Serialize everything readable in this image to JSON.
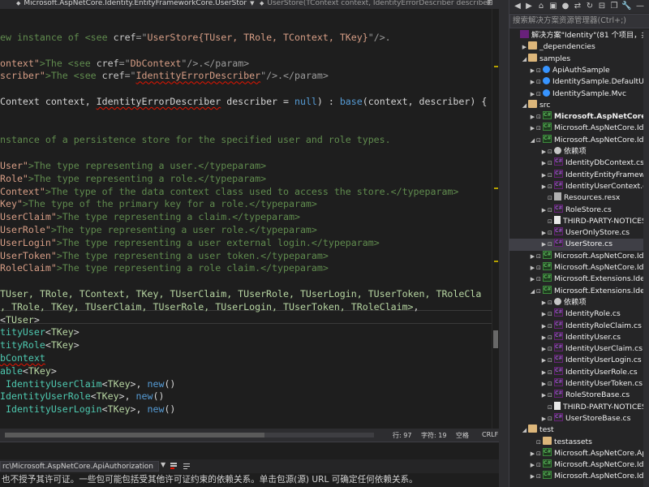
{
  "editor": {
    "tab_left": "Microsoft.AspNetCore.Identity.EntityFrameworkCore.UserStor",
    "tab_right": "UserStore(TContext context, IdentityErrorDescriber describer",
    "code_lines": [
      [
        {
          "t": "ew instance of <see ",
          "c": "c-doc"
        },
        {
          "t": "cref",
          "c": "c-attr"
        },
        {
          "t": "=\"",
          "c": "c-tag"
        },
        {
          "t": "UserStore{TUser, TRole, TContext, TKey}",
          "c": "c-str"
        },
        {
          "t": "\"/>.",
          "c": "c-tag"
        }
      ],
      [],
      [
        {
          "t": "ontext\"",
          "c": "c-str"
        },
        {
          "t": ">The <see ",
          "c": "c-doc"
        },
        {
          "t": "cref",
          "c": "c-attr"
        },
        {
          "t": "=\"",
          "c": "c-tag"
        },
        {
          "t": "DbContext",
          "c": "c-str"
        },
        {
          "t": "\"/>.</param>",
          "c": "c-tag"
        }
      ],
      [
        {
          "t": "scriber\"",
          "c": "c-str"
        },
        {
          "t": ">The <see ",
          "c": "c-doc"
        },
        {
          "t": "cref",
          "c": "c-attr"
        },
        {
          "t": "=\"",
          "c": "c-tag"
        },
        {
          "t": "IdentityErrorDescriber",
          "c": "c-str",
          "sq": true
        },
        {
          "t": "\"/>.</param>",
          "c": "c-tag"
        }
      ],
      [],
      [
        {
          "t": "Context context, ",
          "c": "c-plain"
        },
        {
          "t": "IdentityErrorDescriber",
          "c": "c-plain",
          "sq": true
        },
        {
          "t": " describer = ",
          "c": "c-plain"
        },
        {
          "t": "null",
          "c": "c-kw"
        },
        {
          "t": ") : ",
          "c": "c-plain"
        },
        {
          "t": "base",
          "c": "c-kw"
        },
        {
          "t": "(context, describer) {",
          "c": "c-plain"
        }
      ],
      [],
      [],
      [
        {
          "t": "nstance of a persistence store for the specified user and role types.",
          "c": "c-doc"
        }
      ],
      [],
      [
        {
          "t": "User\"",
          "c": "c-str"
        },
        {
          "t": ">The type representing a user.</typeparam>",
          "c": "c-doc"
        }
      ],
      [
        {
          "t": "Role\"",
          "c": "c-str"
        },
        {
          "t": ">The type representing a role.</typeparam>",
          "c": "c-doc"
        }
      ],
      [
        {
          "t": "Context\"",
          "c": "c-str"
        },
        {
          "t": ">The type of the data context class used to access the store.</typeparam>",
          "c": "c-doc"
        }
      ],
      [
        {
          "t": "Key\"",
          "c": "c-str"
        },
        {
          "t": ">The type of the primary key for a role.</typeparam>",
          "c": "c-doc"
        }
      ],
      [
        {
          "t": "UserClaim\"",
          "c": "c-str"
        },
        {
          "t": ">The type representing a claim.</typeparam>",
          "c": "c-doc"
        }
      ],
      [
        {
          "t": "UserRole\"",
          "c": "c-str"
        },
        {
          "t": ">The type representing a user role.</typeparam>",
          "c": "c-doc"
        }
      ],
      [
        {
          "t": "UserLogin\"",
          "c": "c-str"
        },
        {
          "t": ">The type representing a user external login.</typeparam>",
          "c": "c-doc"
        }
      ],
      [
        {
          "t": "UserToken\"",
          "c": "c-str"
        },
        {
          "t": ">The type representing a user token.</typeparam>",
          "c": "c-doc"
        }
      ],
      [
        {
          "t": "RoleClaim\"",
          "c": "c-str"
        },
        {
          "t": ">The type representing a role claim.</typeparam>",
          "c": "c-doc"
        }
      ],
      [],
      [
        {
          "t": "TUser, TRole, TContext, TKey, TUserClaim, TUserRole, TUserLogin, TUserToken, TRoleCla",
          "c": "c-tp"
        }
      ],
      [
        {
          "t": ", TRole, TKey, TUserClaim, TUserRole, TUserLogin, TUserToken, TRoleClaim>",
          "c": "c-tp"
        },
        {
          "t": ",",
          "c": "c-plain"
        }
      ],
      [
        {
          "t": "<",
          "c": "c-plain"
        },
        {
          "t": "TUser",
          "c": "c-tp"
        },
        {
          "t": ">",
          "c": "c-plain"
        }
      ],
      [
        {
          "t": "tityUser",
          "c": "c-type"
        },
        {
          "t": "<",
          "c": "c-plain"
        },
        {
          "t": "TKey",
          "c": "c-tp"
        },
        {
          "t": ">",
          "c": "c-plain"
        }
      ],
      [
        {
          "t": "tityRole",
          "c": "c-type"
        },
        {
          "t": "<",
          "c": "c-plain"
        },
        {
          "t": "TKey",
          "c": "c-tp"
        },
        {
          "t": ">",
          "c": "c-plain"
        }
      ],
      [
        {
          "t": "bContext",
          "c": "c-type",
          "sq": true
        }
      ],
      [
        {
          "t": "able",
          "c": "c-type"
        },
        {
          "t": "<",
          "c": "c-plain"
        },
        {
          "t": "TKey",
          "c": "c-tp"
        },
        {
          "t": ">",
          "c": "c-plain"
        }
      ],
      [
        {
          "t": " IdentityUserClaim",
          "c": "c-type"
        },
        {
          "t": "<",
          "c": "c-plain"
        },
        {
          "t": "TKey",
          "c": "c-tp"
        },
        {
          "t": ">, ",
          "c": "c-plain"
        },
        {
          "t": "new",
          "c": "c-kw"
        },
        {
          "t": "()",
          "c": "c-plain"
        }
      ],
      [
        {
          "t": "IdentityUserRole",
          "c": "c-type"
        },
        {
          "t": "<",
          "c": "c-plain"
        },
        {
          "t": "TKey",
          "c": "c-tp"
        },
        {
          "t": ">, ",
          "c": "c-plain"
        },
        {
          "t": "new",
          "c": "c-kw"
        },
        {
          "t": "()",
          "c": "c-plain"
        }
      ],
      [
        {
          "t": " IdentityUserLogin",
          "c": "c-type"
        },
        {
          "t": "<",
          "c": "c-plain"
        },
        {
          "t": "TKey",
          "c": "c-tp"
        },
        {
          "t": ">, ",
          "c": "c-plain"
        },
        {
          "t": "new",
          "c": "c-kw"
        },
        {
          "t": "()",
          "c": "c-plain"
        }
      ]
    ]
  },
  "status": {
    "line": "行: 97",
    "char": "字符: 19",
    "spaces": "空格",
    "eol": "CRLF"
  },
  "output": {
    "source_combo": "rc\\Microsoft.AspNetCore.ApiAuthorization",
    "message": "也不授予其许可证。一些包可能包括受其他许可证约束的依赖关系。单击包源(源) URL 可确定任何依赖关系。"
  },
  "solution_explorer": {
    "search_placeholder": "搜索解决方案资源管理器(Ctrl+;)",
    "items": [
      {
        "label": "解决方案\"Identity\"(81 个项目，共 8",
        "depth": 0,
        "chev": "",
        "icon": "ic-sln",
        "bold": false
      },
      {
        "label": "_dependencies",
        "depth": 1,
        "chev": "▶",
        "icon": "ic-folder",
        "bold": false
      },
      {
        "label": "samples",
        "depth": 1,
        "chev": "◢",
        "icon": "ic-folder",
        "bold": false
      },
      {
        "label": "ApiAuthSample",
        "depth": 2,
        "chev": "▶",
        "icon": "ic-globe",
        "bold": false
      },
      {
        "label": "IdentitySample.DefaultUI",
        "depth": 2,
        "chev": "▶",
        "icon": "ic-globe",
        "bold": false
      },
      {
        "label": "IdentitySample.Mvc",
        "depth": 2,
        "chev": "▶",
        "icon": "ic-globe",
        "bold": false
      },
      {
        "label": "src",
        "depth": 1,
        "chev": "◢",
        "icon": "ic-folder",
        "bold": false
      },
      {
        "label": "Microsoft.AspNetCore.ApiAu",
        "depth": 2,
        "chev": "▶",
        "icon": "ic-csproj",
        "bold": true
      },
      {
        "label": "Microsoft.AspNetCore.Identi",
        "depth": 2,
        "chev": "▶",
        "icon": "ic-csproj",
        "bold": false
      },
      {
        "label": "Microsoft.AspNetCore.Identi",
        "depth": 2,
        "chev": "◢",
        "icon": "ic-csproj",
        "bold": false
      },
      {
        "label": "依赖项",
        "depth": 3,
        "chev": "▶",
        "icon": "ic-deps",
        "bold": false
      },
      {
        "label": "IdentityDbContext.cs",
        "depth": 3,
        "chev": "▶",
        "icon": "ic-cs",
        "bold": false
      },
      {
        "label": "IdentityEntityFramework",
        "depth": 3,
        "chev": "▶",
        "icon": "ic-cs",
        "bold": false
      },
      {
        "label": "IdentityUserContext.cs",
        "depth": 3,
        "chev": "▶",
        "icon": "ic-cs",
        "bold": false
      },
      {
        "label": "Resources.resx",
        "depth": 3,
        "chev": "",
        "icon": "ic-res",
        "bold": false
      },
      {
        "label": "RoleStore.cs",
        "depth": 3,
        "chev": "▶",
        "icon": "ic-cs",
        "bold": false
      },
      {
        "label": "THIRD-PARTY-NOTICES.t",
        "depth": 3,
        "chev": "",
        "icon": "ic-file",
        "bold": false
      },
      {
        "label": "UserOnlyStore.cs",
        "depth": 3,
        "chev": "▶",
        "icon": "ic-cs",
        "bold": false
      },
      {
        "label": "UserStore.cs",
        "depth": 3,
        "chev": "▶",
        "icon": "ic-cs",
        "bold": false
      },
      {
        "label": "Microsoft.AspNetCore.Identi",
        "depth": 2,
        "chev": "▶",
        "icon": "ic-csproj",
        "bold": false
      },
      {
        "label": "Microsoft.AspNetCore.Identi",
        "depth": 2,
        "chev": "▶",
        "icon": "ic-csproj",
        "bold": false
      },
      {
        "label": "Microsoft.Extensions.Identit",
        "depth": 2,
        "chev": "▶",
        "icon": "ic-csproj",
        "bold": false
      },
      {
        "label": "Microsoft.Extensions.Identit",
        "depth": 2,
        "chev": "◢",
        "icon": "ic-csproj",
        "bold": false
      },
      {
        "label": "依赖项",
        "depth": 3,
        "chev": "▶",
        "icon": "ic-deps",
        "bold": false
      },
      {
        "label": "IdentityRole.cs",
        "depth": 3,
        "chev": "▶",
        "icon": "ic-cs",
        "bold": false
      },
      {
        "label": "IdentityRoleClaim.cs",
        "depth": 3,
        "chev": "▶",
        "icon": "ic-cs",
        "bold": false
      },
      {
        "label": "IdentityUser.cs",
        "depth": 3,
        "chev": "▶",
        "icon": "ic-cs",
        "bold": false
      },
      {
        "label": "IdentityUserClaim.cs",
        "depth": 3,
        "chev": "▶",
        "icon": "ic-cs",
        "bold": false
      },
      {
        "label": "IdentityUserLogin.cs",
        "depth": 3,
        "chev": "▶",
        "icon": "ic-cs",
        "bold": false
      },
      {
        "label": "IdentityUserRole.cs",
        "depth": 3,
        "chev": "▶",
        "icon": "ic-cs",
        "bold": false
      },
      {
        "label": "IdentityUserToken.cs",
        "depth": 3,
        "chev": "▶",
        "icon": "ic-cs",
        "bold": false
      },
      {
        "label": "RoleStoreBase.cs",
        "depth": 3,
        "chev": "▶",
        "icon": "ic-cs",
        "bold": false
      },
      {
        "label": "THIRD-PARTY-NOTICES.t",
        "depth": 3,
        "chev": "",
        "icon": "ic-file",
        "bold": false
      },
      {
        "label": "UserStoreBase.cs",
        "depth": 3,
        "chev": "▶",
        "icon": "ic-cs",
        "bold": false
      },
      {
        "label": "test",
        "depth": 1,
        "chev": "◢",
        "icon": "ic-folder",
        "bold": false
      },
      {
        "label": "testassets",
        "depth": 2,
        "chev": "",
        "icon": "ic-folder",
        "bold": false
      },
      {
        "label": "Microsoft.AspNetCore.ApiAu",
        "depth": 2,
        "chev": "▶",
        "icon": "ic-csproj",
        "bold": false
      },
      {
        "label": "Microsoft.AspNetCore.Identi",
        "depth": 2,
        "chev": "▶",
        "icon": "ic-csproj",
        "bold": false
      },
      {
        "label": "Microsoft.AspNetCore.Identi",
        "depth": 2,
        "chev": "▶",
        "icon": "ic-csproj",
        "bold": false
      }
    ],
    "selected_label": "UserStore.cs"
  }
}
